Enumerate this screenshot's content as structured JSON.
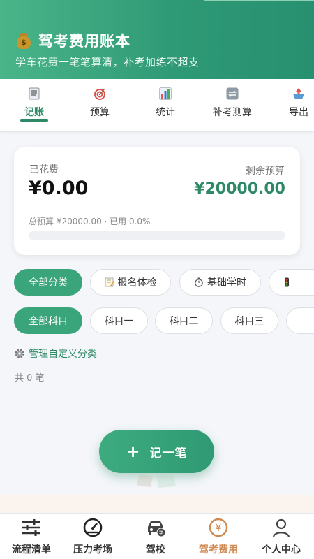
{
  "header": {
    "title": "驾考费用账本",
    "subtitle": "学车花费一笔笔算清，补考加练不超支",
    "icon": "money-bag-icon"
  },
  "tabs": [
    {
      "label": "记账",
      "icon": "receipt-icon",
      "active": true
    },
    {
      "label": "预算",
      "icon": "target-icon",
      "active": false
    },
    {
      "label": "统计",
      "icon": "bar-chart-icon",
      "active": false
    },
    {
      "label": "补考测算",
      "icon": "repeat-icon",
      "active": false
    },
    {
      "label": "导出",
      "icon": "export-icon",
      "active": false
    }
  ],
  "summary": {
    "spent_label": "已花费",
    "spent_value": "¥0.00",
    "remaining_label": "剩余预算",
    "remaining_value": "¥20000.00",
    "budget_text": "总预算 ¥20000.00 · 已用 0.0%",
    "used_fraction": 0.0
  },
  "category_chips": [
    {
      "label": "全部分类",
      "active": true
    },
    {
      "label": "报名体检",
      "icon": "memo-icon"
    },
    {
      "label": "基础学时",
      "icon": "stopwatch-icon"
    },
    {
      "label": "",
      "icon": "traffic-light-icon"
    }
  ],
  "subject_chips": [
    {
      "label": "全部科目",
      "active": true
    },
    {
      "label": "科目一"
    },
    {
      "label": "科目二"
    },
    {
      "label": "科目三"
    },
    {
      "label": ""
    }
  ],
  "manage_label": "管理自定义分类",
  "count_text": "共 0 笔",
  "fab": {
    "label": "记一笔",
    "icon": "plus-icon"
  },
  "bottom_nav": [
    {
      "label": "流程清单",
      "icon": "sliders-icon"
    },
    {
      "label": "压力考场",
      "icon": "speedometer-icon"
    },
    {
      "label": "驾校",
      "icon": "car-school-icon"
    },
    {
      "label": "驾考费用",
      "icon": "yuan-coin-icon",
      "active": true
    },
    {
      "label": "个人中心",
      "icon": "person-icon"
    }
  ],
  "colors": {
    "brand_green": "#2e8a66",
    "active_nav": "#d08a52"
  }
}
